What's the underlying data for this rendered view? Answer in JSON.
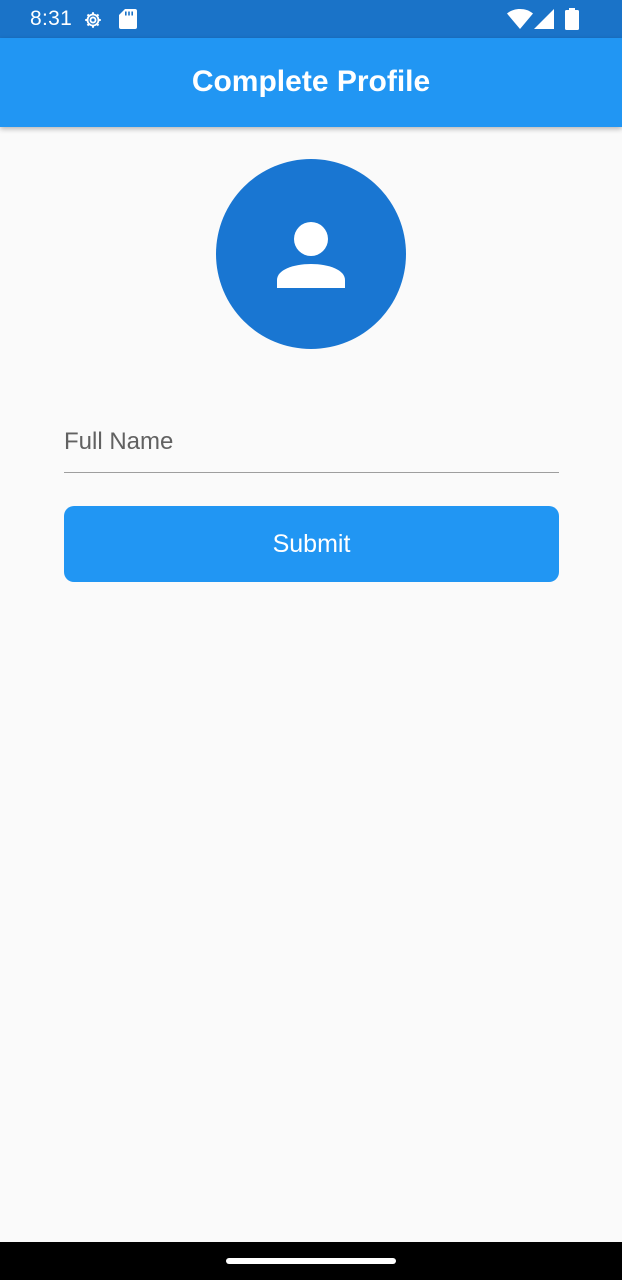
{
  "status_bar": {
    "time": "8:31",
    "icons": [
      "settings-gear-icon",
      "sd-card-icon",
      "wifi-icon",
      "cell-signal-icon",
      "battery-icon"
    ]
  },
  "app_bar": {
    "title": "Complete Profile"
  },
  "avatar": {
    "icon": "person-icon"
  },
  "form": {
    "full_name_placeholder": "Full Name",
    "full_name_value": "",
    "submit_label": "Submit"
  },
  "colors": {
    "status_bar": "#1a73c8",
    "app_bar": "#2196f3",
    "avatar": "#1976d2",
    "button": "#2196f3",
    "background": "#fafafa"
  }
}
